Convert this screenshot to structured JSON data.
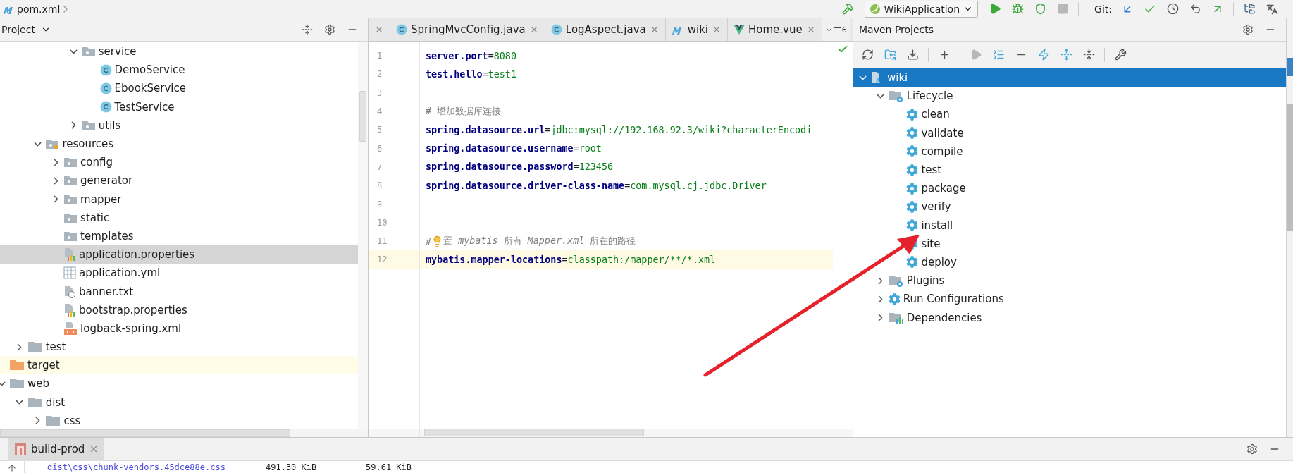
{
  "breadcrumb": {
    "file": "pom.xml"
  },
  "toolbar": {
    "run_config": "WikiApplication",
    "git_label": "Git:",
    "buttons": [
      {
        "kind": "run",
        "disabled": false
      },
      {
        "kind": "debug",
        "disabled": false
      },
      {
        "kind": "coverage",
        "disabled": false
      },
      {
        "kind": "stop",
        "disabled": true
      }
    ]
  },
  "project": {
    "title": "Project",
    "tree": [
      {
        "children": [
          {
            "children": [
              {
                "children": [
                  {
                    "children": [
                      {
                        "label": "service",
                        "kind": "folder",
                        "expanded": true,
                        "selected": false,
                        "children": [
                          {
                            "label": "DemoService",
                            "kind": "class",
                            "selected": false
                          },
                          {
                            "label": "EbookService",
                            "kind": "class",
                            "selected": false
                          },
                          {
                            "label": "TestService",
                            "kind": "class",
                            "selected": false
                          }
                        ]
                      },
                      {
                        "label": "utils",
                        "kind": "folder",
                        "expanded": false,
                        "selected": false
                      }
                    ]
                  }
                ]
              },
              {
                "label": "resources",
                "kind": "resources",
                "expanded": true,
                "selected": false,
                "children": [
                  {
                    "label": "config",
                    "kind": "folder",
                    "expanded": false,
                    "selected": false
                  },
                  {
                    "label": "generator",
                    "kind": "folder",
                    "expanded": false,
                    "selected": false
                  },
                  {
                    "label": "mapper",
                    "kind": "folder",
                    "expanded": false,
                    "selected": false
                  },
                  {
                    "label": "static",
                    "kind": "folder",
                    "selected": false
                  },
                  {
                    "label": "templates",
                    "kind": "folder",
                    "selected": false
                  },
                  {
                    "label": "application.properties",
                    "kind": "properties",
                    "selected": true
                  },
                  {
                    "label": "application.yml",
                    "kind": "yml",
                    "selected": false
                  },
                  {
                    "label": "banner.txt",
                    "kind": "text",
                    "selected": false
                  },
                  {
                    "label": "bootstrap.properties",
                    "kind": "properties",
                    "selected": false
                  },
                  {
                    "label": "logback-spring.xml",
                    "kind": "xml",
                    "selected": false
                  }
                ]
              }
            ]
          },
          {
            "label": "test",
            "kind": "plain-folder",
            "expanded": false,
            "selected": false
          }
        ]
      },
      {
        "label": "target",
        "kind": "excluded",
        "selected": false
      },
      {
        "label": "web",
        "kind": "plain-folder",
        "expanded": true,
        "selected": false,
        "children": [
          {
            "label": "dist",
            "kind": "plain-folder",
            "expanded": true,
            "selected": false,
            "children": [
              {
                "label": "css",
                "kind": "plain-folder",
                "expanded": false,
                "selected": false
              }
            ]
          }
        ]
      }
    ]
  },
  "editor": {
    "tabs": [
      {
        "kind": "cut"
      },
      {
        "kind": "java",
        "label": "SpringMvcConfig.java"
      },
      {
        "kind": "java",
        "label": "LogAspect.java"
      },
      {
        "kind": "maven",
        "label": "wiki"
      },
      {
        "kind": "vue",
        "label": "Home.vue"
      }
    ],
    "overflow_count": "6",
    "lines": [
      {
        "number": "1",
        "current": false,
        "segments": [
          {
            "kind": "key",
            "text": "server.port"
          },
          {
            "kind": "op",
            "text": "="
          },
          {
            "kind": "value",
            "text": "8080"
          }
        ]
      },
      {
        "number": "2",
        "current": false,
        "segments": [
          {
            "kind": "key",
            "text": "test.hello"
          },
          {
            "kind": "op",
            "text": "="
          },
          {
            "kind": "value",
            "text": "test1"
          }
        ]
      },
      {
        "number": "3",
        "current": false
      },
      {
        "number": "4",
        "current": false,
        "segments": [
          {
            "kind": "comment",
            "text": "# 增加数据库连接"
          }
        ]
      },
      {
        "number": "5",
        "current": false,
        "segments": [
          {
            "kind": "key",
            "text": "spring.datasource.url"
          },
          {
            "kind": "op",
            "text": "="
          },
          {
            "kind": "value",
            "text": "jdbc:mysql://192.168.92.3/wiki?characterEncodi"
          }
        ]
      },
      {
        "number": "6",
        "current": false,
        "segments": [
          {
            "kind": "key",
            "text": "spring.datasource.username"
          },
          {
            "kind": "op",
            "text": "="
          },
          {
            "kind": "value",
            "text": "root"
          }
        ]
      },
      {
        "number": "7",
        "current": false,
        "segments": [
          {
            "kind": "key",
            "text": "spring.datasource.password"
          },
          {
            "kind": "op",
            "text": "="
          },
          {
            "kind": "value",
            "text": "123456"
          }
        ]
      },
      {
        "number": "8",
        "current": false,
        "segments": [
          {
            "kind": "key",
            "text": "spring.datasource.driver-class-name"
          },
          {
            "kind": "op",
            "text": "="
          },
          {
            "kind": "value",
            "text": "com.mysql.cj.jdbc.Driver"
          }
        ]
      },
      {
        "number": "9",
        "current": false
      },
      {
        "number": "10",
        "current": false
      },
      {
        "number": "11",
        "current": false,
        "segments": [
          {
            "kind": "comment",
            "text": "#"
          },
          {
            "kind": "bulb"
          },
          {
            "kind": "comment",
            "text": "置 *mybatis* 所有 *Mapper.xml* 所在的路径"
          }
        ]
      },
      {
        "number": "12",
        "current": true,
        "segments": [
          {
            "kind": "key",
            "text": "mybatis.mapper-locations"
          },
          {
            "kind": "op",
            "text": "="
          },
          {
            "kind": "value",
            "text": "classpath:/mapper/**/*.xml"
          }
        ]
      }
    ]
  },
  "maven": {
    "title": "Maven Projects",
    "toolbar": [
      {
        "kind": "refresh",
        "disabled": false
      },
      {
        "kind": "reimport",
        "disabled": false
      },
      {
        "kind": "download",
        "disabled": false
      },
      {
        "kind": "sep"
      },
      {
        "kind": "add",
        "disabled": false
      },
      {
        "kind": "sep"
      },
      {
        "kind": "run",
        "disabled": true
      },
      {
        "kind": "execute",
        "disabled": false
      },
      {
        "kind": "offline",
        "disabled": false
      },
      {
        "kind": "skip-tests",
        "disabled": false
      },
      {
        "kind": "expand",
        "disabled": false
      },
      {
        "kind": "collapse",
        "disabled": false
      },
      {
        "kind": "sep"
      },
      {
        "kind": "settings",
        "disabled": false
      }
    ],
    "tree": [
      {
        "label": "wiki",
        "kind": "project",
        "expanded": true,
        "selected": true,
        "children": [
          {
            "label": "Lifecycle",
            "kind": "group",
            "expanded": true,
            "selected": false,
            "children": [
              {
                "label": "clean",
                "kind": "goal",
                "selected": false
              },
              {
                "label": "validate",
                "kind": "goal",
                "selected": false
              },
              {
                "label": "compile",
                "kind": "goal",
                "selected": false
              },
              {
                "label": "test",
                "kind": "goal",
                "selected": false
              },
              {
                "label": "package",
                "kind": "goal",
                "selected": false
              },
              {
                "label": "verify",
                "kind": "goal",
                "selected": false
              },
              {
                "label": "install",
                "kind": "goal",
                "selected": false
              },
              {
                "label": "site",
                "kind": "goal",
                "selected": false
              },
              {
                "label": "deploy",
                "kind": "goal",
                "selected": false
              }
            ]
          },
          {
            "label": "Plugins",
            "kind": "group",
            "expanded": false,
            "selected": false
          },
          {
            "label": "Run Configurations",
            "kind": "goal",
            "expanded": false,
            "selected": false
          },
          {
            "label": "Dependencies",
            "kind": "deps",
            "expanded": false,
            "selected": false
          }
        ]
      }
    ]
  },
  "run_panel": {
    "tab": "build-prod",
    "output": [
      {
        "file": "dist\\css\\chunk-vendors.45dce88e.css",
        "size": "491.30 KiB",
        "gzipped": "59.61 KiB"
      }
    ]
  }
}
